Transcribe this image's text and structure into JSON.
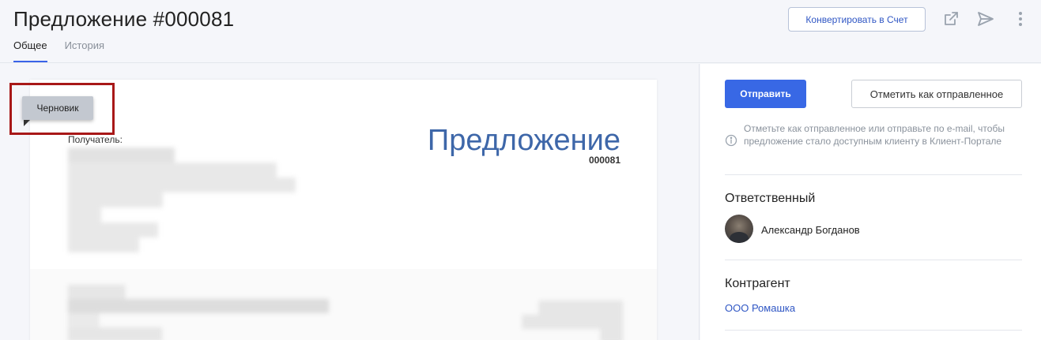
{
  "header": {
    "title": "Предложение #000081",
    "tabs": [
      {
        "label": "Общее",
        "active": true
      },
      {
        "label": "История",
        "active": false
      }
    ],
    "convert_label": "Конвертировать в Счет",
    "icons": [
      "external-link-icon",
      "send-icon",
      "more-vertical-icon"
    ]
  },
  "document": {
    "status_badge": "Черновик",
    "heading": "Предложение",
    "number": "000081",
    "recipient_label": "Получатель:"
  },
  "sidebar": {
    "send_label": "Отправить",
    "mark_sent_label": "Отметить как отправленное",
    "info_text": "Отметьте как отправленное или отправьте по e-mail, чтобы предложение стало доступным клиенту в Клиент-Портале",
    "responsible_title": "Ответственный",
    "responsible_name": "Александр Богданов",
    "contractor_title": "Контрагент",
    "contractor_name": "ООО Ромашка"
  },
  "colors": {
    "accent": "#3868e5",
    "link": "#2f56c4",
    "doc_title": "#3e67a9",
    "highlight_frame": "#a81818"
  }
}
